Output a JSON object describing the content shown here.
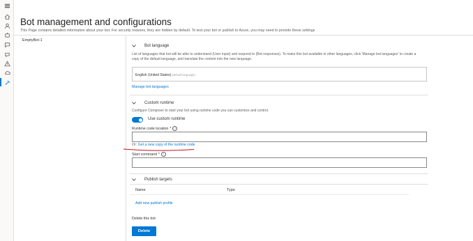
{
  "page": {
    "title": "Bot management and configurations",
    "description": "This Page contains detailed information about your bot. For security reasons, they are hidden by default. To test your bot or publish to Azure, you may need to provide these settings"
  },
  "sidebar": {
    "bot_item": "EmptyBot-1"
  },
  "rail_icons": [
    "menu-icon",
    "home-icon",
    "user-icon",
    "bot-icon",
    "chat-icon",
    "warning-icon",
    "user-group-icon",
    "cloud-icon",
    "wrench-icon"
  ],
  "bot_language": {
    "heading": "Bot language",
    "description_line1": "List of languages that bot will be able to understand (User input) and respond to (Bot responses). To make this bot available in other languages, click 'Manage bot languages' to create a",
    "description_line2": "copy of the default language, and translate the content into the new language.",
    "language": "English (United States)",
    "language_tag": "(default language)",
    "manage_link": "Manage bot languages"
  },
  "custom_runtime": {
    "heading": "Custom runtime",
    "description": "Configure Composer to start your bot using runtime code you can customize and control.",
    "toggle_label": "Use custom runtime",
    "toggle_on": true,
    "location_label": "Runtime code location",
    "location_value": "",
    "or_text": "Or:",
    "copy_link": "Get a new copy of the runtime code",
    "start_label": "Start command",
    "start_value": "",
    "required_mark": "*",
    "info_glyph": "i"
  },
  "publish": {
    "heading": "Publish targets",
    "col_name": "Name",
    "col_type": "Type",
    "add_link": "Add new publish profile"
  },
  "delete": {
    "label": "Delete this bot",
    "button": "Delete"
  },
  "colors": {
    "accent": "#0078d4",
    "annotation": "#c50f1f"
  }
}
